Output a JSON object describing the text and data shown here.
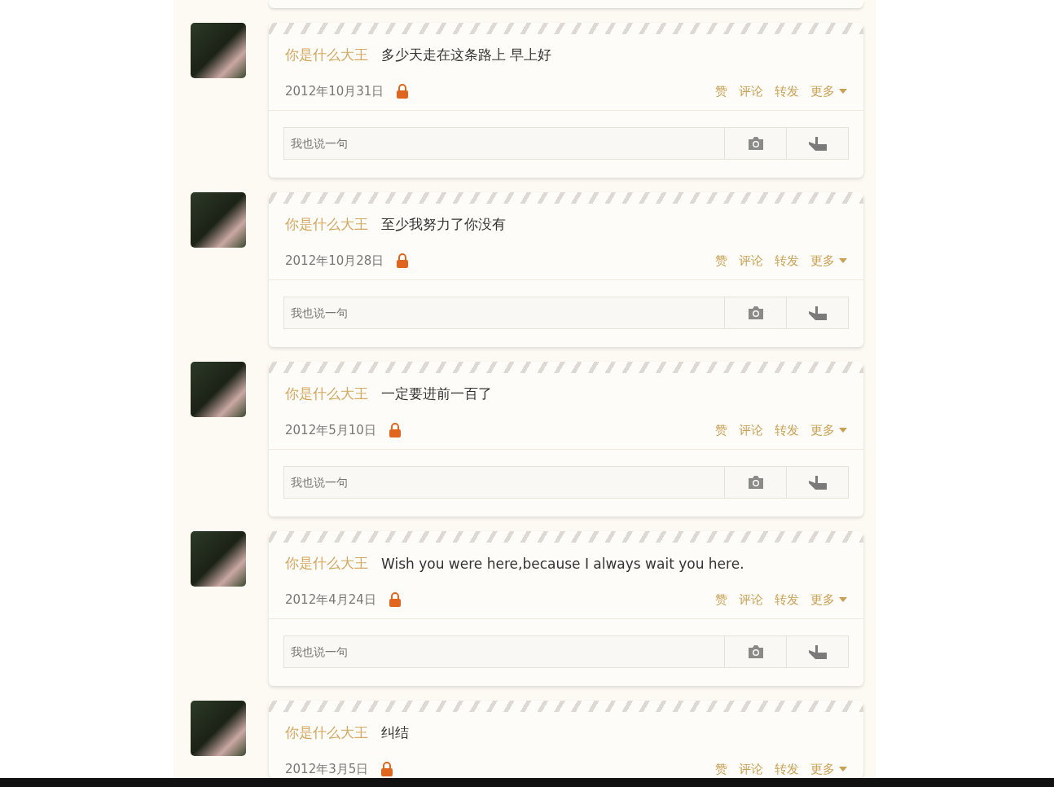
{
  "posts": [
    {
      "author": "你是什么大王",
      "text": "多少天走在这条路上 早上好",
      "date": "2012年10月31日",
      "private": true,
      "actions": [
        "赞",
        "评论",
        "转发"
      ],
      "more": "更多",
      "comment_placeholder": "我也说一句"
    },
    {
      "author": "你是什么大王",
      "text": "至少我努力了你没有",
      "date": "2012年10月28日",
      "private": true,
      "actions": [
        "赞",
        "评论",
        "转发"
      ],
      "more": "更多",
      "comment_placeholder": "我也说一句"
    },
    {
      "author": "你是什么大王",
      "text": "一定要进前一百了",
      "date": "2012年5月10日",
      "private": true,
      "actions": [
        "赞",
        "评论",
        "转发"
      ],
      "more": "更多",
      "comment_placeholder": "我也说一句"
    },
    {
      "author": "你是什么大王",
      "text": "Wish you were here,because I always wait you here.",
      "date": "2012年4月24日",
      "private": true,
      "actions": [
        "赞",
        "评论",
        "转发"
      ],
      "more": "更多",
      "comment_placeholder": "我也说一句"
    },
    {
      "author": "你是什么大王",
      "text": "纠结",
      "date": "2012年3月5日",
      "private": true,
      "actions": [
        "赞",
        "评论",
        "转发"
      ],
      "more": "更多"
    }
  ]
}
